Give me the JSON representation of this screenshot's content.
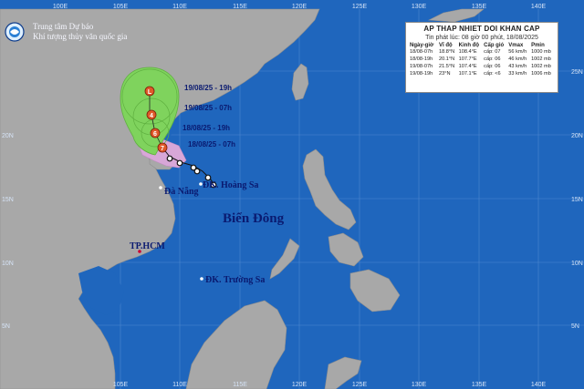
{
  "agency": {
    "line1": "Trung tâm Dự báo",
    "line2": "Khí tượng thủy văn quốc gia",
    "logo_label": "NCHMF"
  },
  "panel": {
    "title": "AP THAP NHIET DOI KHAN CAP",
    "issued": "Tin phát lúc: 08 giờ 00 phút, 18/08/2025",
    "headers": [
      "Ngày-giờ",
      "Vĩ độ",
      "Kinh độ",
      "Cấp gió",
      "Vmax",
      "Pmin"
    ],
    "rows": [
      [
        "18/08-07h",
        "18.8°N",
        "108.4°E",
        "cấp: 07",
        "56 km/h",
        "1000 mb"
      ],
      [
        "18/08-19h",
        "20.1°N",
        "107.7°E",
        "cấp: 06",
        "46 km/h",
        "1002 mb"
      ],
      [
        "19/08-07h",
        "21.5°N",
        "107.4°E",
        "cấp: 06",
        "43 km/h",
        "1002 mb"
      ],
      [
        "19/08-19h",
        "23°N",
        "107.1°E",
        "cấp: <6",
        "33 km/h",
        "1006 mb"
      ]
    ]
  },
  "map": {
    "sea_name": "Biển Đông",
    "places": {
      "da_nang": "Đà Nẵng",
      "hoang_sa": "ĐK. Hoàng Sa",
      "tp_hcm": "TP.HCM",
      "truong_sa": "ĐK. Trường Sa"
    },
    "forecast_labels": [
      "19/08/25 - 19h",
      "19/08/25 - 07h",
      "18/08/25 - 19h",
      "18/08/25 - 07h"
    ],
    "marker_letters": [
      "L",
      "4",
      "6",
      "7"
    ],
    "lon_labels": [
      "100E",
      "105E",
      "110E",
      "115E",
      "120E",
      "125E",
      "130E",
      "135E",
      "140E"
    ],
    "lat_labels": [
      "25N",
      "20N",
      "15N",
      "10N",
      "5N"
    ],
    "colors": {
      "sea": "#1f66bd",
      "land": "#a8a8a8",
      "cone": "#7fd35d",
      "warning_zone": "#d8a7d8",
      "marker": "#e0582a"
    }
  }
}
